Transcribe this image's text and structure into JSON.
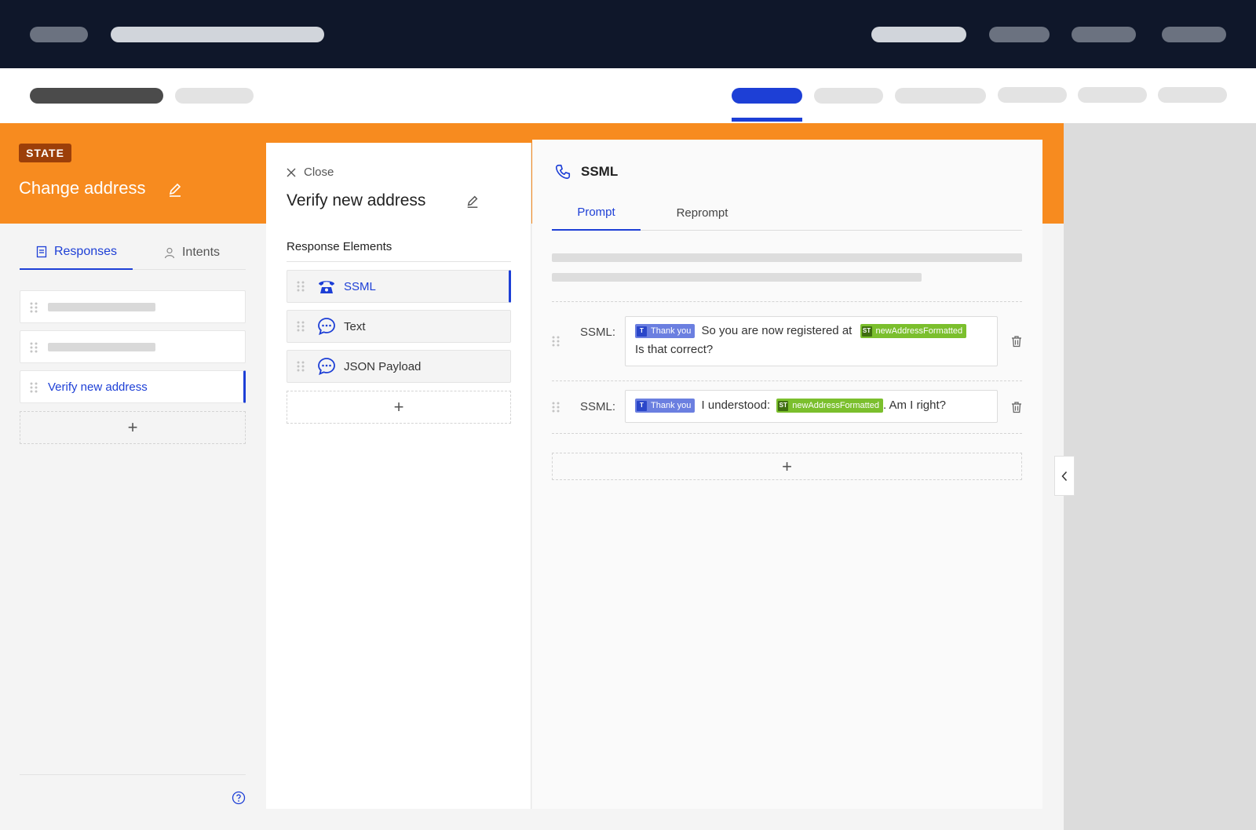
{
  "state": {
    "badge": "STATE",
    "title": "Change address"
  },
  "left_panel": {
    "tabs": [
      {
        "label": "Responses",
        "icon": "responses-icon",
        "active": true
      },
      {
        "label": "Intents",
        "icon": "user-icon",
        "active": false
      }
    ],
    "items": [
      {
        "label": "",
        "placeholder": true
      },
      {
        "label": "",
        "placeholder": true
      },
      {
        "label": "Verify new address",
        "active": true
      }
    ],
    "add_label": "+"
  },
  "middle_panel": {
    "close_label": "Close",
    "title": "Verify new address",
    "section_title": "Response Elements",
    "elements": [
      {
        "label": "SSML",
        "icon": "phone-icon",
        "active": true
      },
      {
        "label": "Text",
        "icon": "chat-bubble-icon"
      },
      {
        "label": "JSON Payload",
        "icon": "chat-bubble-icon"
      }
    ],
    "add_label": "+"
  },
  "right_panel": {
    "header": "SSML",
    "tabs": [
      {
        "label": "Prompt",
        "active": true
      },
      {
        "label": "Reprompt"
      }
    ],
    "rows": [
      {
        "label": "SSML:",
        "chip1": {
          "tag": "T",
          "text": "Thank you"
        },
        "text1": "So you are now registered at",
        "chip2": {
          "tag": "ST",
          "text": "newAddressFormatted"
        },
        "text2": "Is that correct?"
      },
      {
        "label": "SSML:",
        "chip1": {
          "tag": "T",
          "text": "Thank you"
        },
        "text1": "I understood:",
        "chip2": {
          "tag": "ST",
          "text": "newAddressFormatted"
        },
        "text2": ". Am I right?"
      }
    ],
    "add_label": "+"
  },
  "colors": {
    "accent": "#1d3fd6",
    "orange": "#f78b1f",
    "badge": "#9c3f09",
    "nav": "#0f172a"
  }
}
